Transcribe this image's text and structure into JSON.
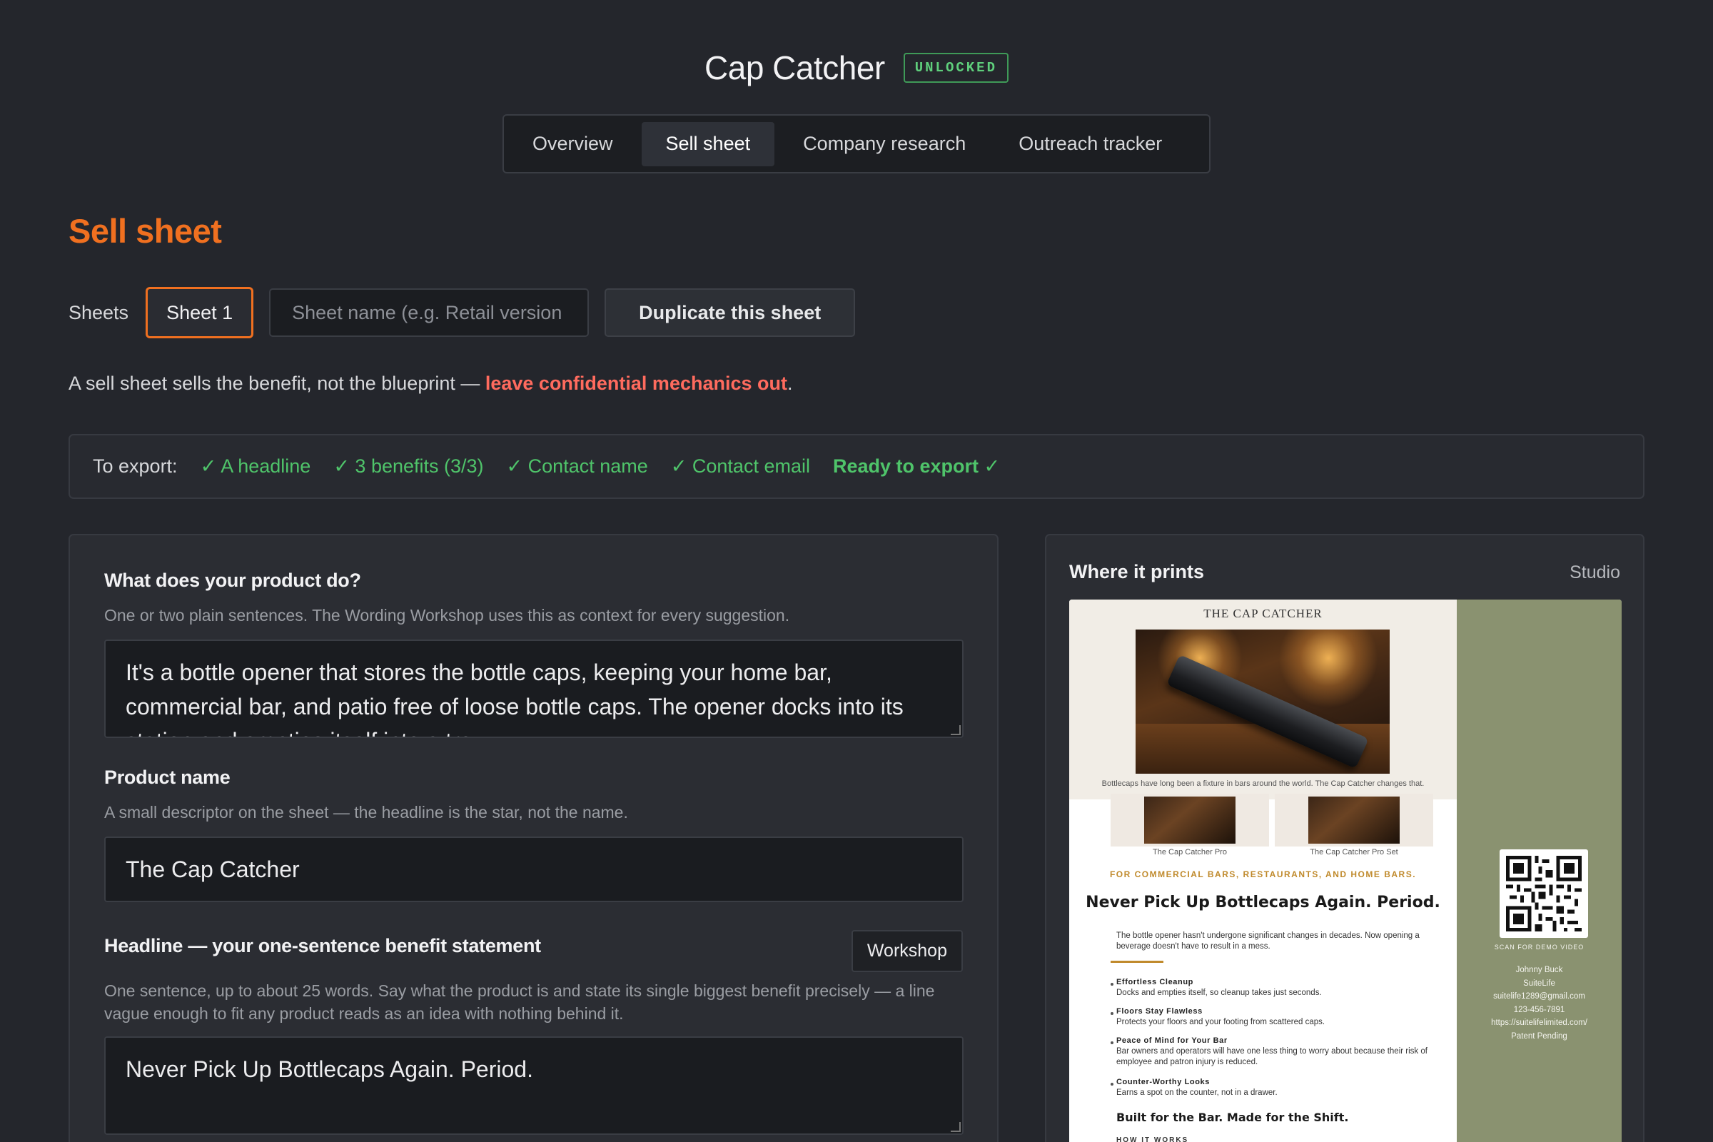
{
  "header": {
    "title": "Cap Catcher",
    "badge": "UNLOCKED"
  },
  "tabs": [
    {
      "label": "Overview",
      "active": false
    },
    {
      "label": "Sell sheet",
      "active": true
    },
    {
      "label": "Company research",
      "active": false
    },
    {
      "label": "Outreach tracker",
      "active": false
    }
  ],
  "section": {
    "title": "Sell sheet"
  },
  "sheets": {
    "label": "Sheets",
    "items": [
      "Sheet 1"
    ],
    "name_placeholder": "Sheet name (e.g. Retail version",
    "duplicate_label": "Duplicate this sheet"
  },
  "note": {
    "before": "A sell sheet sells the benefit, not the blueprint — ",
    "warning": "leave confidential mechanics out",
    "after": "."
  },
  "export": {
    "label": "To export:",
    "checks": [
      "✓ A headline",
      "✓ 3 benefits (3/3)",
      "✓ Contact name",
      "✓ Contact email"
    ],
    "ready": "Ready to export ✓"
  },
  "form": {
    "product_do": {
      "label": "What does your product do?",
      "help": "One or two plain sentences. The Wording Workshop uses this as context for every suggestion.",
      "value": "It's a bottle opener that stores the bottle caps, keeping your home bar, commercial bar, and patio free of loose bottle caps. The opener docks into its station and empties itself into a tray."
    },
    "product_name": {
      "label": "Product name",
      "help": "A small descriptor on the sheet — the headline is the star, not the name.",
      "value": "The Cap Catcher"
    },
    "headline": {
      "label": "Headline — your one-sentence benefit statement",
      "workshop_label": "Workshop",
      "help": "One sentence, up to about 25 words. Say what the product is and state its single biggest benefit precisely — a line vague enough to fit any product reads as an idea with nothing behind it.",
      "value": "Never Pick Up Bottlecaps Again. Period."
    }
  },
  "preview": {
    "title": "Where it prints",
    "mode": "Studio",
    "sheet": {
      "brand": "THE CAP CATCHER",
      "caption": "Bottlecaps have long been a fixture in bars around the world. The Cap Catcher changes that.",
      "thumbs": [
        "The Cap Catcher Pro",
        "The Cap Catcher Pro Set"
      ],
      "tagline": "FOR COMMERCIAL BARS, RESTAURANTS, AND HOME BARS.",
      "headline": "Never Pick Up Bottlecaps Again. Period.",
      "intro": "The bottle opener hasn't undergone significant changes in decades. Now opening a beverage doesn't have to result in a mess.",
      "benefits": [
        {
          "title": "Effortless Cleanup",
          "text": "Docks and empties itself, so cleanup takes just seconds."
        },
        {
          "title": "Floors Stay Flawless",
          "text": "Protects your floors and your footing from scattered caps."
        },
        {
          "title": "Peace of Mind for Your Bar",
          "text": "Bar owners and operators will have one less thing to worry about because their risk of employee and patron injury is reduced."
        },
        {
          "title": "Counter-Worthy Looks",
          "text": "Earns a spot on the counter, not in a drawer."
        }
      ],
      "built": "Built for the Bar.  Made for the Shift.",
      "how": "HOW IT WORKS",
      "scan": "SCAN FOR DEMO VIDEO",
      "contact": [
        "Johnny Buck",
        "SuiteLife",
        "suitelife1289@gmail.com",
        "123-456-7891",
        "https://suitelifelimited.com/",
        "Patent Pending"
      ]
    }
  },
  "colors": {
    "accent": "#f07020",
    "success": "#4fc46a",
    "warning": "#ff6b5e",
    "background": "#24262c",
    "sheet_side": "#8a9270",
    "sheet_gold": "#c08a2c"
  }
}
